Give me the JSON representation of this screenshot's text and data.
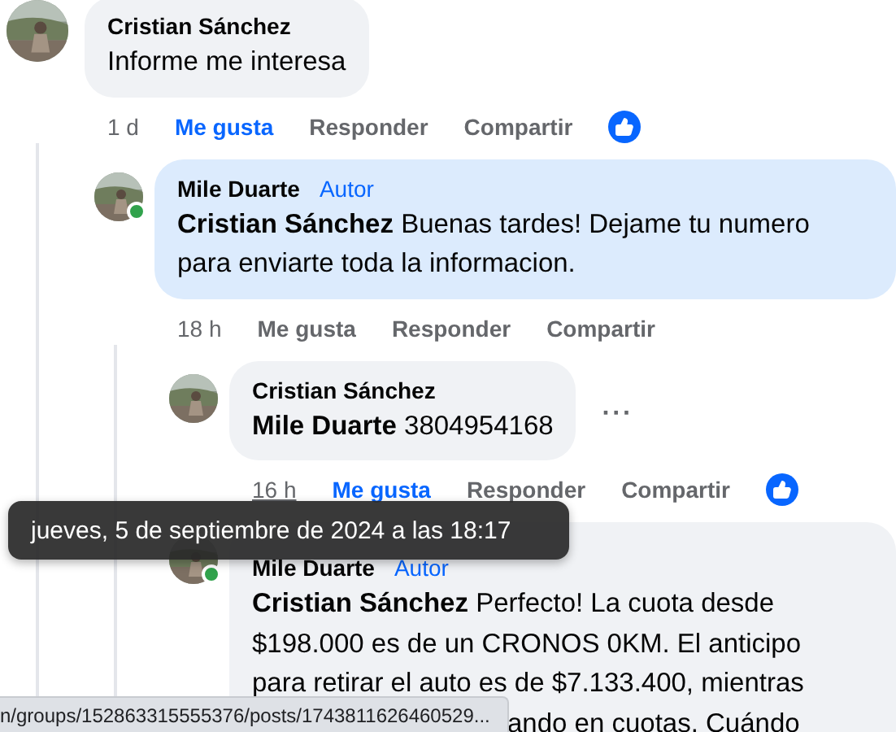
{
  "comments": [
    {
      "author": "Cristian Sánchez",
      "lines": [
        "Informe me interesa"
      ],
      "time": "1 d",
      "time_hovered": false,
      "like_label": "Me gusta",
      "liked": true,
      "reply_label": "Responder",
      "share_label": "Compartir",
      "reaction": true,
      "children": [
        {
          "author": "Mile Duarte",
          "badge": "Autor",
          "mention": "Cristian Sánchez",
          "lines": [
            "Buenas tardes! Dejame tu numero",
            "para enviarte toda la informacion."
          ],
          "highlighted": true,
          "online": true,
          "time": "18 h",
          "time_hovered": false,
          "like_label": "Me gusta",
          "liked": false,
          "reply_label": "Responder",
          "share_label": "Compartir",
          "children": [
            {
              "author": "Cristian Sánchez",
              "mention": "Mile Duarte",
              "lines": [
                "3804954168"
              ],
              "time": "16 h",
              "time_hovered": true,
              "like_label": "Me gusta",
              "liked": true,
              "reply_label": "Responder",
              "share_label": "Compartir",
              "reaction": true,
              "more_label": "···"
            },
            {
              "author": "Mile Duarte",
              "badge": "Autor",
              "mention": "Cristian Sánchez",
              "lines": [
                "Perfecto! La cuota desde",
                "$198.000 es de un CRONOS 0KM. El anticipo",
                "para retirar el auto es de $7.133.400, mientras"
              ],
              "covered_line": "ando en cuotas. Cuándo",
              "online": true
            }
          ]
        }
      ]
    }
  ],
  "tooltip": {
    "text": "jueves, 5 de septiembre de 2024 a las 18:17"
  },
  "status_bar": {
    "url": "n/groups/152863315555376/posts/1743811626460529..."
  }
}
